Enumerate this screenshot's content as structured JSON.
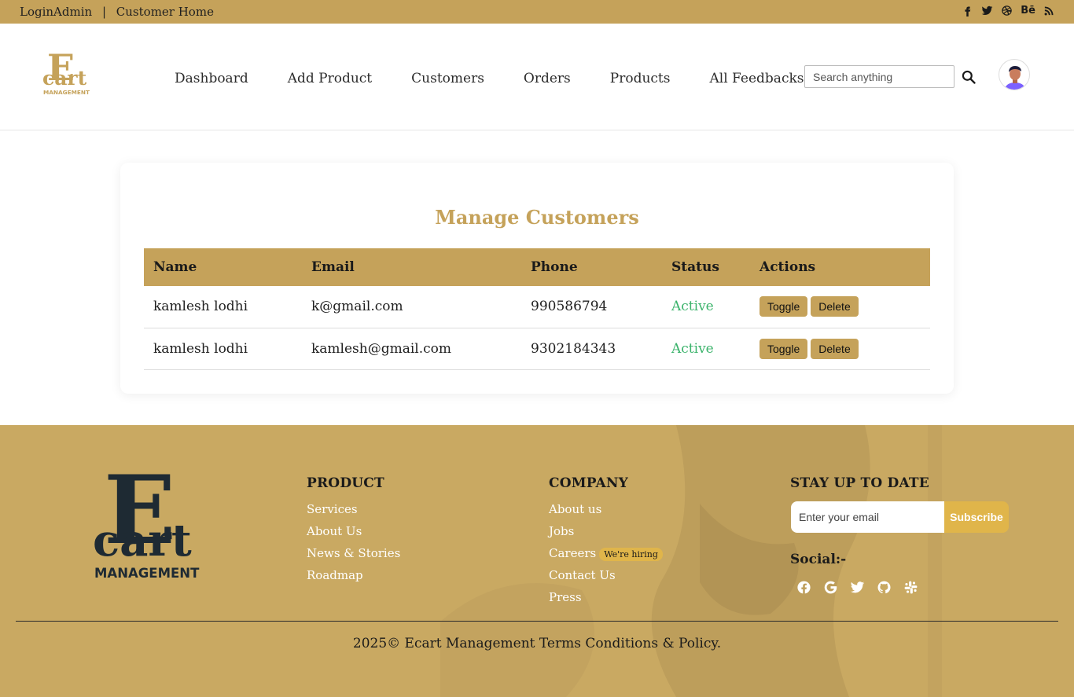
{
  "topbar": {
    "link1": "LoginAdmin",
    "separator": "|",
    "link2": "Customer Home",
    "social": [
      "facebook-icon",
      "twitter-icon",
      "dribbble-icon",
      "behance-icon",
      "rss-icon"
    ],
    "behance_label": "Bē"
  },
  "header": {
    "nav": [
      "Dashboard",
      "Add Product",
      "Customers",
      "Orders",
      "Products",
      "All Feedbacks"
    ],
    "search_placeholder": "Search anything"
  },
  "main": {
    "title": "Manage Customers",
    "columns": [
      "Name",
      "Email",
      "Phone",
      "Status",
      "Actions"
    ],
    "rows": [
      {
        "name": "kamlesh lodhi",
        "email": "k@gmail.com",
        "phone": "990586794",
        "status": "Active"
      },
      {
        "name": "kamlesh lodhi",
        "email": "kamlesh@gmail.com",
        "phone": "9302184343",
        "status": "Active"
      }
    ],
    "toggle_label": "Toggle",
    "delete_label": "Delete"
  },
  "footer": {
    "product": {
      "heading": "PRODUCT",
      "items": [
        "Services",
        "About Us",
        "News & Stories",
        "Roadmap"
      ]
    },
    "company": {
      "heading": "COMPANY",
      "items": [
        "About us",
        "Jobs",
        "Careers",
        "Contact Us",
        "Press"
      ],
      "hiring_badge": "We're hiring"
    },
    "newsletter": {
      "heading": "STAY UP TO DATE",
      "placeholder": "Enter your email",
      "button": "Subscribe"
    },
    "social_label": "Social:-",
    "social": [
      "facebook-icon",
      "google-icon",
      "twitter-icon",
      "github-icon",
      "slack-icon"
    ],
    "copyright": "2025© Ecart Management Terms Conditions & Policy."
  },
  "colors": {
    "accent": "#c5a25a",
    "footer_bg": "#c9a962",
    "active_status": "#3bb36b",
    "dark": "#1a1a1a"
  }
}
